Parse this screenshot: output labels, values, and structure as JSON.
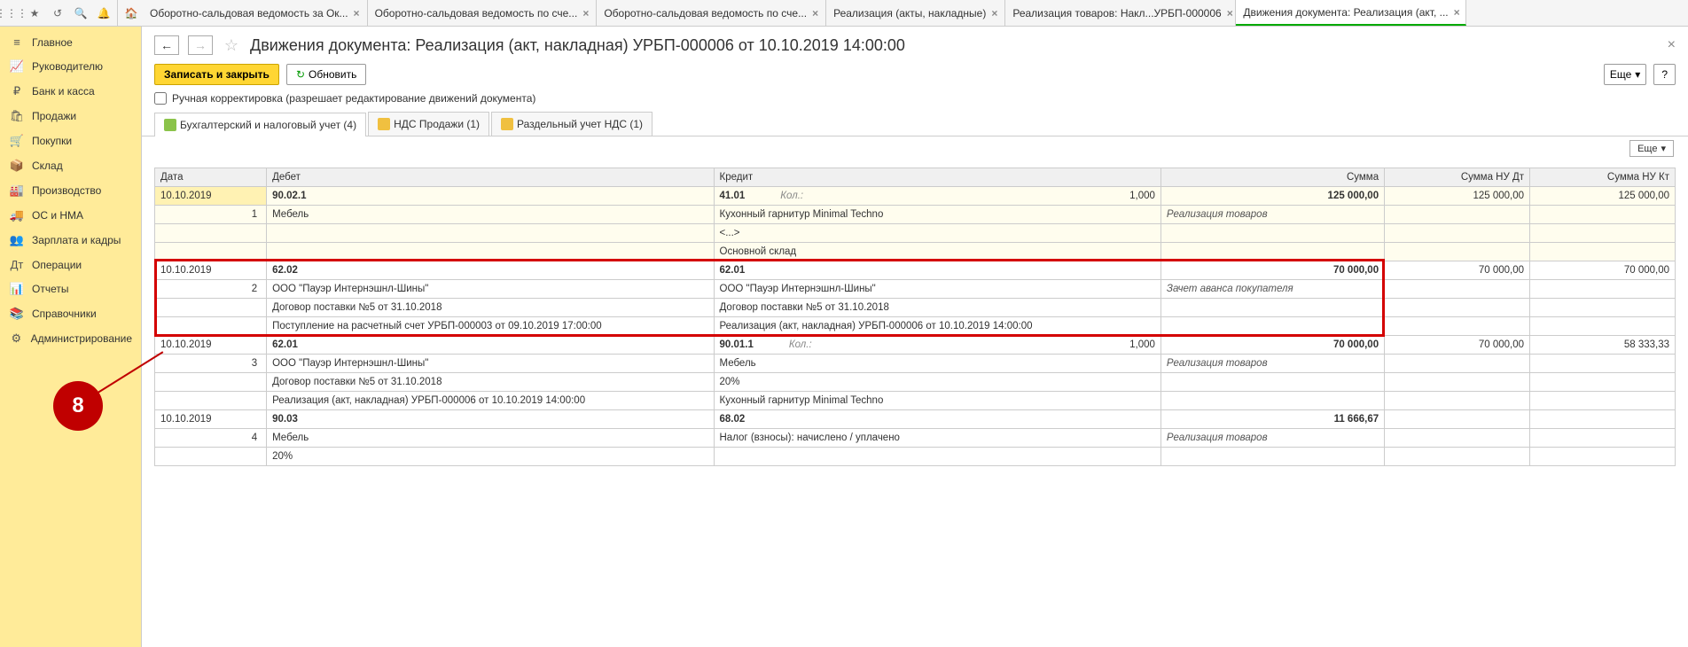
{
  "toolbarIcons": [
    "apps",
    "star",
    "history",
    "search",
    "bell"
  ],
  "tabs": [
    {
      "label": "Оборотно-сальдовая ведомость за Ок...",
      "active": false
    },
    {
      "label": "Оборотно-сальдовая ведомость по сче...",
      "active": false
    },
    {
      "label": "Оборотно-сальдовая ведомость по сче...",
      "active": false
    },
    {
      "label": "Реализация (акты, накладные)",
      "active": false
    },
    {
      "label": "Реализация товаров: Накл...УРБП-000006",
      "active": false
    },
    {
      "label": "Движения документа: Реализация (акт, ...",
      "active": true
    }
  ],
  "sidebar": [
    {
      "icon": "≡",
      "label": "Главное"
    },
    {
      "icon": "📈",
      "label": "Руководителю"
    },
    {
      "icon": "₽",
      "label": "Банк и касса"
    },
    {
      "icon": "🛍",
      "label": "Продажи"
    },
    {
      "icon": "🛒",
      "label": "Покупки"
    },
    {
      "icon": "📦",
      "label": "Склад"
    },
    {
      "icon": "🏭",
      "label": "Производство"
    },
    {
      "icon": "🚚",
      "label": "ОС и НМА"
    },
    {
      "icon": "👥",
      "label": "Зарплата и кадры"
    },
    {
      "icon": "Дт",
      "label": "Операции"
    },
    {
      "icon": "📊",
      "label": "Отчеты"
    },
    {
      "icon": "📚",
      "label": "Справочники"
    },
    {
      "icon": "⚙",
      "label": "Администрирование"
    }
  ],
  "pageTitle": "Движения документа: Реализация (акт, накладная) УРБП-000006 от 10.10.2019 14:00:00",
  "actions": {
    "save": "Записать и закрыть",
    "refresh": "Обновить",
    "more": "Еще",
    "help": "?"
  },
  "manualEdit": "Ручная корректировка (разрешает редактирование движений документа)",
  "subtabs": [
    {
      "label": "Бухгалтерский и налоговый учет (4)",
      "active": true,
      "color": "green"
    },
    {
      "label": "НДС Продажи (1)",
      "active": false,
      "color": "yellow"
    },
    {
      "label": "Раздельный учет НДС (1)",
      "active": false,
      "color": "yellow"
    }
  ],
  "tableMore": "Еще",
  "columns": [
    "Дата",
    "Дебет",
    "Кредит",
    "Сумма",
    "Сумма НУ Дт",
    "Сумма НУ Кт"
  ],
  "rows": [
    {
      "date": "10.10.2019",
      "n": "1",
      "highlight": true,
      "debitAcc": "90.02.1",
      "debitLines": [
        "Мебель"
      ],
      "kreditAcc": "41.01",
      "kol": "Кол.:",
      "kolVal": "1,000",
      "kreditLines": [
        "Кухонный гарнитур Minimal Techno",
        "<...>",
        "Основной склад"
      ],
      "sum": "125 000,00",
      "sumNote": "Реализация товаров",
      "dt": "125 000,00",
      "kt": "125 000,00"
    },
    {
      "date": "10.10.2019",
      "n": "2",
      "red": true,
      "debitAcc": "62.02",
      "debitLines": [
        "ООО \"Пауэр Интернэшнл-Шины\"",
        "Договор поставки №5 от 31.10.2018",
        "Поступление на расчетный счет УРБП-000003 от 09.10.2019 17:00:00"
      ],
      "kreditAcc": "62.01",
      "kreditLines": [
        "ООО \"Пауэр Интернэшнл-Шины\"",
        "Договор поставки №5 от 31.10.2018",
        "Реализация (акт, накладная) УРБП-000006 от 10.10.2019 14:00:00"
      ],
      "sum": "70 000,00",
      "sumNote": "Зачет аванса покупателя",
      "dt": "70 000,00",
      "kt": "70 000,00"
    },
    {
      "date": "10.10.2019",
      "n": "3",
      "debitAcc": "62.01",
      "debitLines": [
        "ООО \"Пауэр Интернэшнл-Шины\"",
        "Договор поставки №5 от 31.10.2018",
        "Реализация (акт, накладная) УРБП-000006 от 10.10.2019 14:00:00"
      ],
      "kreditAcc": "90.01.1",
      "kol": "Кол.:",
      "kolVal": "1,000",
      "kreditLines": [
        "Мебель",
        "20%",
        "Кухонный гарнитур Minimal Techno"
      ],
      "sum": "70 000,00",
      "sumNote": "Реализация товаров",
      "dt": "70 000,00",
      "kt": "58 333,33"
    },
    {
      "date": "10.10.2019",
      "n": "4",
      "debitAcc": "90.03",
      "debitLines": [
        "Мебель",
        "20%"
      ],
      "kreditAcc": "68.02",
      "kreditLines": [
        "Налог (взносы): начислено / уплачено"
      ],
      "sum": "11 666,67",
      "sumNote": "Реализация товаров",
      "dt": "",
      "kt": ""
    }
  ],
  "callout": "8"
}
